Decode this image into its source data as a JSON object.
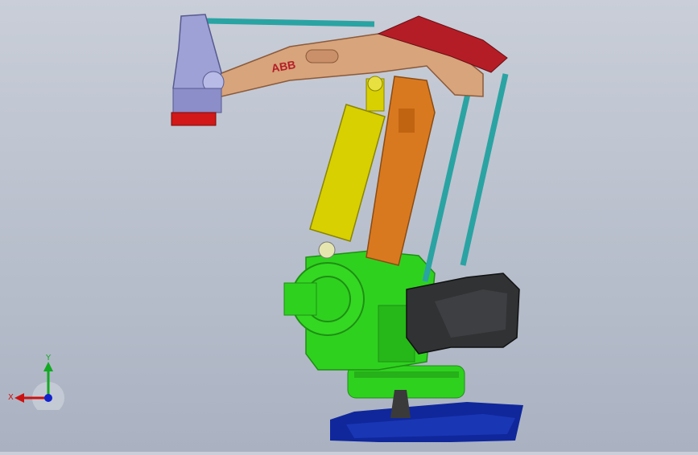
{
  "viewport": {
    "background_top": "#c9ced8",
    "background_bottom": "#aab2c2"
  },
  "robot": {
    "brand_label": "ABB",
    "colors": {
      "upper_arm": "#d7a47c",
      "upper_arm_dark": "#a66a45",
      "lower_arm": "#d9791f",
      "cylinder": "#d8d000",
      "base": "#2fd11f",
      "base_dark": "#1e8f14",
      "counterweight": "#303234",
      "tie_rods": "#2aa3a3",
      "wrist": "#9ea1d6",
      "tool": "#d21818",
      "mount_plate": "#10279b",
      "linkage": "#b51d26"
    }
  },
  "triad": {
    "x_label": "X",
    "y_label": "Y",
    "x_color": "#cc1111",
    "y_color": "#11aa22",
    "z_color": "#1122cc"
  }
}
